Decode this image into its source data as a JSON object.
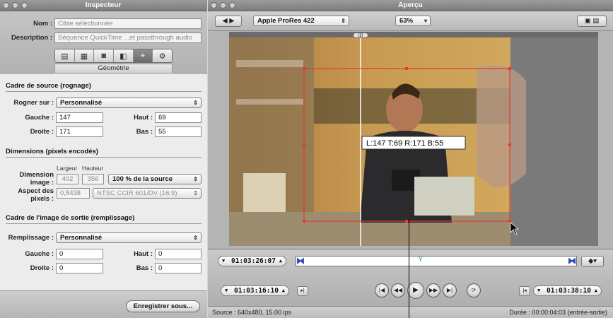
{
  "inspector": {
    "title": "Inspecteur",
    "name_label": "Nom :",
    "name_value": "Cible sélectionnée",
    "description_label": "Description :",
    "description_value": "Séquence QuickTime ...et passthrough audio",
    "tabs": [
      {
        "icon": "document-icon",
        "glyph": "▤"
      },
      {
        "icon": "film-icon",
        "glyph": "▦"
      },
      {
        "icon": "video-icon",
        "glyph": "◙"
      },
      {
        "icon": "stack-icon",
        "glyph": "◧"
      },
      {
        "icon": "geometry-icon",
        "glyph": "⌖",
        "selected": true
      },
      {
        "icon": "gear-icon",
        "glyph": "⚙"
      }
    ],
    "active_tab": "Géométrie",
    "source_section": "Cadre de source (rognage)",
    "crop_label": "Rogner sur :",
    "crop_value": "Personnalisé",
    "left_label": "Gauche :",
    "left_value": "147",
    "top_label": "Haut :",
    "top_value": "69",
    "right_label": "Droite :",
    "right_value": "171",
    "bottom_label": "Bas :",
    "bottom_value": "55",
    "dimensions_section": "Dimensions (pixels encodés)",
    "width_col": "Largeur",
    "height_col": "Hauteur",
    "image_dim_label_1": "Dimension",
    "image_dim_label_2": "image :",
    "image_width": "402",
    "image_height": "356",
    "size_popup": "100 % de la source",
    "aspect_label_1": "Aspect des",
    "aspect_label_2": "pixels :",
    "aspect_value": "0,8438",
    "aspect_popup": "NTSC CCIR 601/DV (16:9)",
    "output_section": "Cadre de l'image de sortie (remplissage)",
    "fill_label": "Remplissage :",
    "fill_value": "Personnalisé",
    "out_left_label": "Gauche :",
    "out_left_value": "0",
    "out_top_label": "Haut :",
    "out_top_value": "0",
    "out_right_label": "Droite :",
    "out_right_value": "0",
    "out_bottom_label": "Bas :",
    "out_bottom_value": "0",
    "save_button": "Enregistrer sous..."
  },
  "preview": {
    "title": "Aperçu",
    "format": "Apple ProRes 422",
    "zoom": "63%",
    "crop_tooltip": "L:147 T:69 R:171 B:55",
    "in_timecode": "01:03:26:07",
    "current_timecode": "01:03:16:10",
    "out_timecode": "01:03:38:10",
    "status_source": "Source : 640x480, 15.00 ips",
    "status_duration": "Durée : 00:00:04:03 (entrée-sortie)"
  }
}
